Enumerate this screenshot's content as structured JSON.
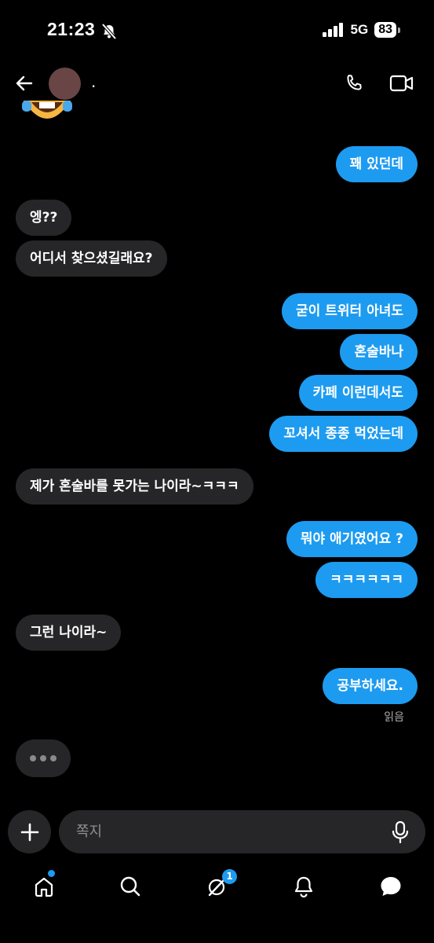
{
  "status": {
    "time": "21:23",
    "network": "5G",
    "battery": "83"
  },
  "header": {
    "username": "."
  },
  "messages": [
    {
      "text": "꽤 있던데",
      "side": "out"
    },
    {
      "text": "엥??",
      "side": "in"
    },
    {
      "text": "어디서 찾으셨길래요?",
      "side": "in"
    },
    {
      "text": "굳이 트위터 아녀도",
      "side": "out"
    },
    {
      "text": "혼술바나",
      "side": "out"
    },
    {
      "text": "카페 이런데서도",
      "side": "out"
    },
    {
      "text": "꼬셔서 종종 먹었는데",
      "side": "out"
    },
    {
      "text": "제가 혼술바를 못가는 나이라~ㅋㅋㅋ",
      "side": "in"
    },
    {
      "text": "뭐야 애기였어요 ?",
      "side": "out"
    },
    {
      "text": "ㅋㅋㅋㅋㅋㅋ",
      "side": "out"
    },
    {
      "text": "그런 나이라~",
      "side": "in"
    },
    {
      "text": "공부하세요.",
      "side": "out"
    }
  ],
  "read_receipt": "읽음",
  "composer": {
    "placeholder": "쪽지"
  },
  "nav": {
    "messages_badge": "1"
  },
  "colors": {
    "accent": "#1d9bf0",
    "bubble_in": "#262628",
    "background": "#000000"
  }
}
